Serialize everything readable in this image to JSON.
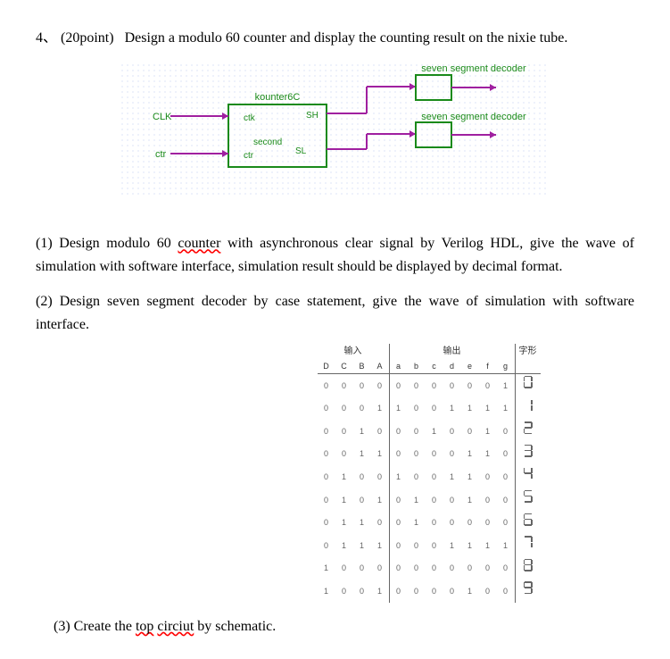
{
  "question": {
    "number": "4、",
    "points": "(20point)",
    "prompt_before": "Design a modulo 60 counter and display the counting result on the nixie tube."
  },
  "diagram": {
    "counter_label": "kounter6C",
    "clk": "CLK",
    "ctr": "ctr",
    "clk_port": "ctk",
    "ctr_port": "ctr",
    "second": "second",
    "sh": "SH",
    "sl": "SL",
    "decoder1": "seven segment decoder",
    "decoder2": "seven segment decoder"
  },
  "parts": {
    "p1_a": "(1) Design modulo 60 ",
    "p1_squiggle": "counter",
    "p1_b": " with asynchronous clear signal by Verilog HDL, give the wave of simulation with software interface, simulation result should be displayed by decimal format.",
    "p2": "(2) Design seven segment decoder by case statement, give the wave of simulation with software interface.",
    "p3_a": "(3) Create the ",
    "p3_sq1": "top",
    "p3_mid": " ",
    "p3_sq2": "circiut",
    "p3_b": " by schematic."
  },
  "table": {
    "head_input": "输入",
    "head_output": "输出",
    "head_glyph": "字形",
    "in_cols": [
      "D",
      "C",
      "B",
      "A"
    ],
    "out_cols": [
      "a",
      "b",
      "c",
      "d",
      "e",
      "f",
      "g"
    ],
    "rows": [
      {
        "in": [
          0,
          0,
          0,
          0
        ],
        "out": [
          0,
          0,
          0,
          0,
          0,
          0,
          1
        ],
        "glyph": "0"
      },
      {
        "in": [
          0,
          0,
          0,
          1
        ],
        "out": [
          1,
          0,
          0,
          1,
          1,
          1,
          1
        ],
        "glyph": "1"
      },
      {
        "in": [
          0,
          0,
          1,
          0
        ],
        "out": [
          0,
          0,
          1,
          0,
          0,
          1,
          0
        ],
        "glyph": "2"
      },
      {
        "in": [
          0,
          0,
          1,
          1
        ],
        "out": [
          0,
          0,
          0,
          0,
          1,
          1,
          0
        ],
        "glyph": "3"
      },
      {
        "in": [
          0,
          1,
          0,
          0
        ],
        "out": [
          1,
          0,
          0,
          1,
          1,
          0,
          0
        ],
        "glyph": "4"
      },
      {
        "in": [
          0,
          1,
          0,
          1
        ],
        "out": [
          0,
          1,
          0,
          0,
          1,
          0,
          0
        ],
        "glyph": "5"
      },
      {
        "in": [
          0,
          1,
          1,
          0
        ],
        "out": [
          0,
          1,
          0,
          0,
          0,
          0,
          0
        ],
        "glyph": "6"
      },
      {
        "in": [
          0,
          1,
          1,
          1
        ],
        "out": [
          0,
          0,
          0,
          1,
          1,
          1,
          1
        ],
        "glyph": "7"
      },
      {
        "in": [
          1,
          0,
          0,
          0
        ],
        "out": [
          0,
          0,
          0,
          0,
          0,
          0,
          0
        ],
        "glyph": "8"
      },
      {
        "in": [
          1,
          0,
          0,
          1
        ],
        "out": [
          0,
          0,
          0,
          0,
          1,
          0,
          0
        ],
        "glyph": "9"
      }
    ]
  }
}
